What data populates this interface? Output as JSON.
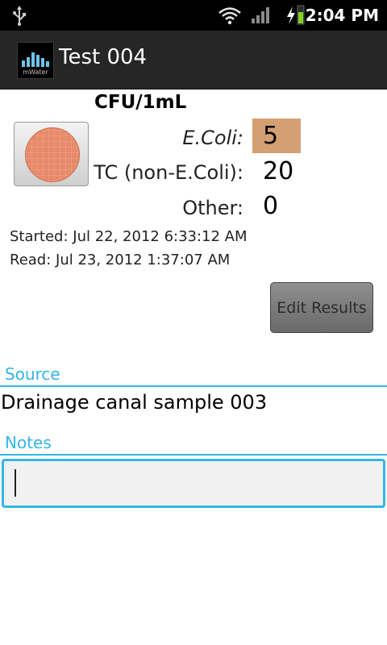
{
  "status_bar": {
    "time": "2:04 PM",
    "icons": [
      "usb-icon",
      "wifi-icon",
      "signal-icon",
      "charging-icon",
      "battery-icon"
    ]
  },
  "app_bar": {
    "logo_text": "mWater",
    "title": "Test 004"
  },
  "results": {
    "units": "CFU/1mL",
    "rows": [
      {
        "label": "E.Coli:",
        "value": "5",
        "highlight": "#d4a073"
      },
      {
        "label": "TC (non-E.Coli):",
        "value": "20"
      },
      {
        "label": "Other:",
        "value": "0"
      }
    ],
    "started": "Started: Jul 22, 2012 6:33:12 AM",
    "read": "Read: Jul 23, 2012 1:37:07 AM",
    "edit_label": "Edit Results"
  },
  "source": {
    "label": "Source",
    "value": "Drainage canal sample 003"
  },
  "notes": {
    "label": "Notes",
    "value": ""
  },
  "colors": {
    "accent": "#33b5e5",
    "action_bar": "#262626",
    "ecoli_highlight": "#d4a073",
    "plate": "#e88a6a"
  }
}
